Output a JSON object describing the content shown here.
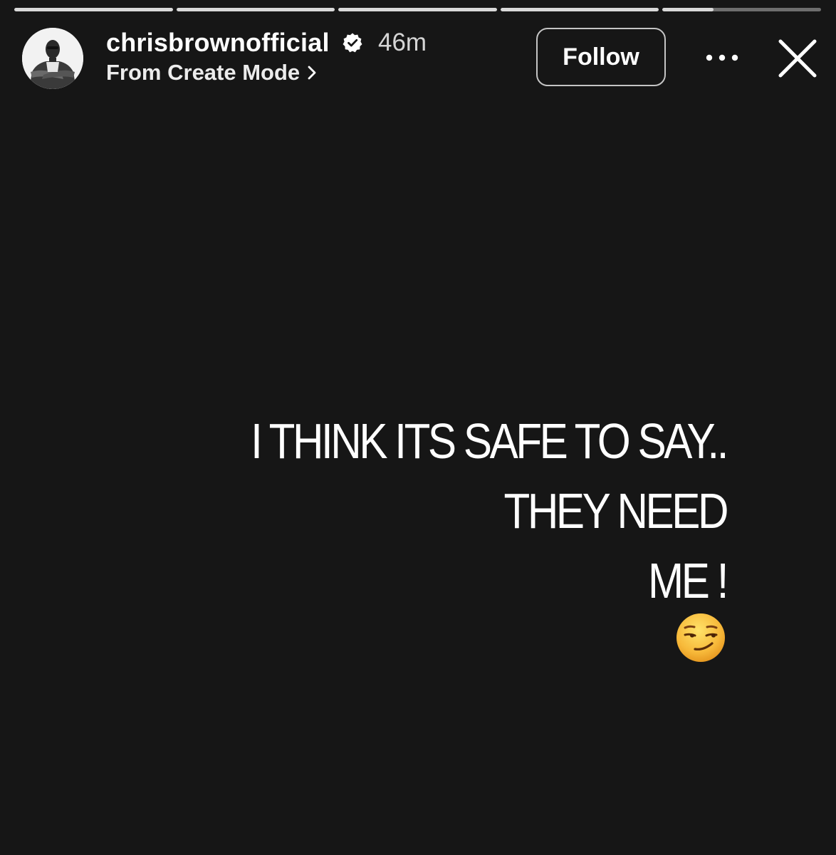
{
  "progress": {
    "segments": [
      1,
      1,
      1,
      1,
      0.32
    ]
  },
  "header": {
    "username": "chrisbrownofficial",
    "verified_icon": "verified-badge-icon",
    "time": "46m",
    "subtitle": "From Create Mode",
    "follow_label": "Follow",
    "more_icon": "more-options-icon",
    "close_icon": "close-icon"
  },
  "story": {
    "text": "I THINK ITS SAFE TO SAY.. THEY NEED\nME !",
    "emoji": "smirking-face-emoji"
  },
  "colors": {
    "background": "#161616",
    "text": "#ffffff",
    "progress_fill": "#d9d9d9"
  }
}
